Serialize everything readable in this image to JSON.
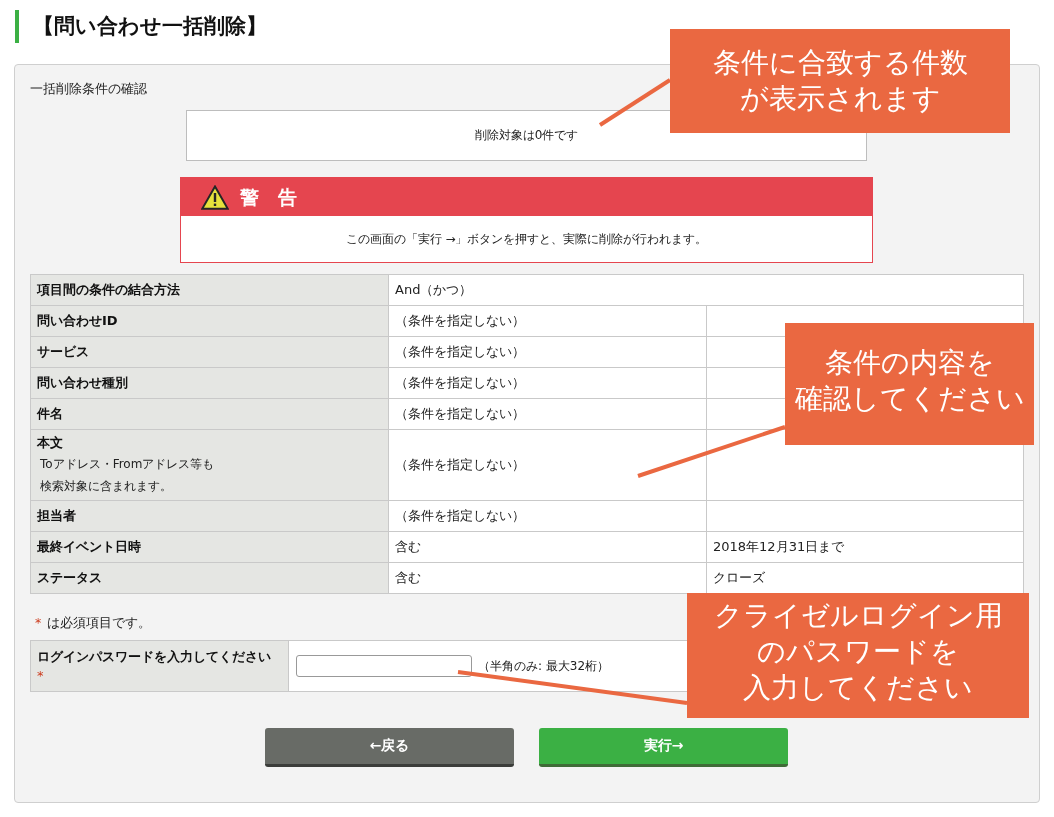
{
  "page": {
    "title": "【問い合わせ一括削除】"
  },
  "confirmation": {
    "heading": "一括削除条件の確認",
    "count_message": "削除対象は0件です",
    "warning": {
      "title": "警　告",
      "message": "この画面の「実行 →」ボタンを押すと、実際に削除が行われます。"
    },
    "conditions": [
      {
        "label": "項目間の条件の結合方法",
        "kind": "combined",
        "value": "And（かつ）"
      },
      {
        "label": "問い合わせID",
        "kind": "split",
        "value": "（条件を指定しない）"
      },
      {
        "label": "サービス",
        "kind": "split",
        "value": "（条件を指定しない）"
      },
      {
        "label": "問い合わせ種別",
        "kind": "split",
        "value": "（条件を指定しない）"
      },
      {
        "label": "件名",
        "kind": "split",
        "value": "（条件を指定しない）"
      },
      {
        "label": "本文",
        "kind": "split",
        "note_lines": [
          "Toアドレス・Fromアドレス等も",
          "検索対象に含まれます。"
        ],
        "value": "（条件を指定しない）"
      },
      {
        "label": "担当者",
        "kind": "split",
        "value": "（条件を指定しない）"
      },
      {
        "label": "最終イベント日時",
        "kind": "split",
        "value": "含む",
        "detail": "2018年12月31日まで"
      },
      {
        "label": "ステータス",
        "kind": "split",
        "value": "含む",
        "detail": "クローズ"
      }
    ],
    "required_note": {
      "mark": "*",
      "text": "は必須項目です。"
    },
    "password": {
      "label": "ログインパスワードを入力してください",
      "required_mark": "*",
      "hint": "（半角のみ: 最大32桁）"
    },
    "buttons": [
      {
        "label": "←戻る",
        "kind": "back"
      },
      {
        "label": "実行→",
        "kind": "submit"
      }
    ]
  },
  "callouts": [
    {
      "lines": [
        "条件に合致する件数",
        "が表示されます"
      ]
    },
    {
      "lines": [
        "条件の内容を",
        "確認してください"
      ]
    },
    {
      "lines": [
        "クライゼルログイン用",
        "のパスワードを",
        "入力してください"
      ]
    }
  ]
}
